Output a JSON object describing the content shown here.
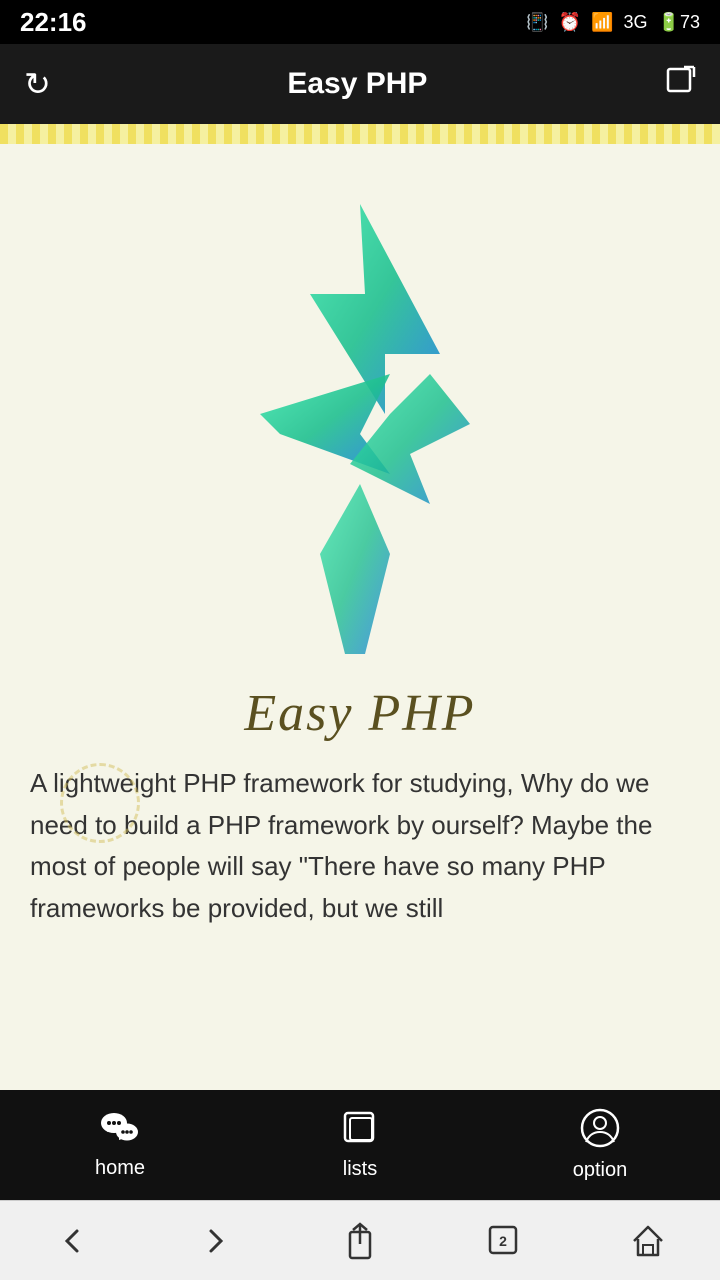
{
  "statusBar": {
    "time": "22:16",
    "batteryLevel": "73"
  },
  "navBar": {
    "title": "Easy PHP",
    "refreshIcon": "↻",
    "editIcon": "✎"
  },
  "mainContent": {
    "appTitle": "Easy PHP",
    "description": "A lightweight PHP framework for studying, Why do we need to build a PHP framework by ourself? Maybe the most of people will say \"There have so many PHP frameworks be provided, but we still"
  },
  "tabBar": {
    "tabs": [
      {
        "id": "home",
        "label": "home",
        "icon": "💬"
      },
      {
        "id": "lists",
        "label": "lists",
        "icon": "▣"
      },
      {
        "id": "option",
        "label": "option",
        "icon": "👤"
      }
    ]
  },
  "bottomNav": {
    "items": [
      {
        "id": "back",
        "icon": "‹"
      },
      {
        "id": "forward",
        "icon": "›"
      },
      {
        "id": "share",
        "icon": "⬆"
      },
      {
        "id": "tabs",
        "icon": "2"
      },
      {
        "id": "home",
        "icon": "⌂"
      }
    ]
  }
}
